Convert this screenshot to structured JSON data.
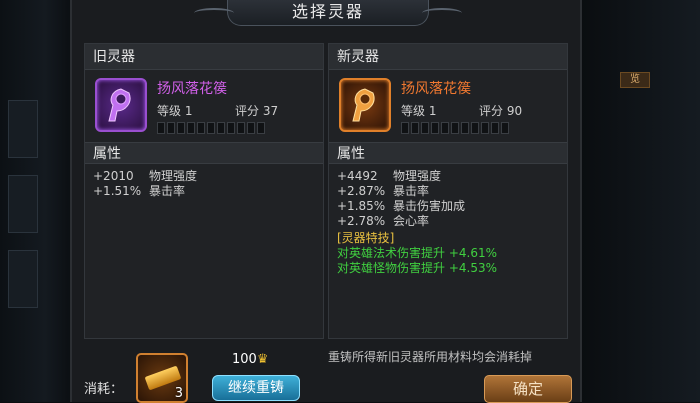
{
  "dialog": {
    "title": "选择灵器",
    "old": {
      "header": "旧灵器",
      "name": "扬风落花篌",
      "level_label": "等级 1",
      "score_label": "评分 37",
      "attr_header": "属性",
      "attrs": [
        {
          "value": "+2010",
          "name": "物理强度"
        },
        {
          "value": "+1.51%",
          "name": "暴击率"
        }
      ]
    },
    "new": {
      "header": "新灵器",
      "name": "扬风落花篌",
      "level_label": "等级 1",
      "score_label": "评分 90",
      "attr_header": "属性",
      "attrs": [
        {
          "value": "+4492",
          "name": "物理强度"
        },
        {
          "value": "+2.87%",
          "name": "暴击率"
        },
        {
          "value": "+1.85%",
          "name": "暴击伤害加成"
        },
        {
          "value": "+2.78%",
          "name": "会心率"
        }
      ],
      "special_header": "[灵器特技]",
      "specials": [
        "对英雄法术伤害提升 +4.61%",
        "对英雄怪物伤害提升 +4.53%"
      ]
    },
    "bottom": {
      "cost_label": "消耗：",
      "material_count": "3",
      "coin_cost": "100",
      "reforge_label": "继续重铸",
      "note": "重铸所得新旧灵器所用材料均会消耗掉",
      "confirm_label": "确定"
    }
  },
  "background": {
    "right_chip": "览"
  },
  "colors": {
    "purple_quality": "#d060e8",
    "orange_quality": "#f07830",
    "special_green": "#40d040",
    "special_header": "#e8c040"
  }
}
